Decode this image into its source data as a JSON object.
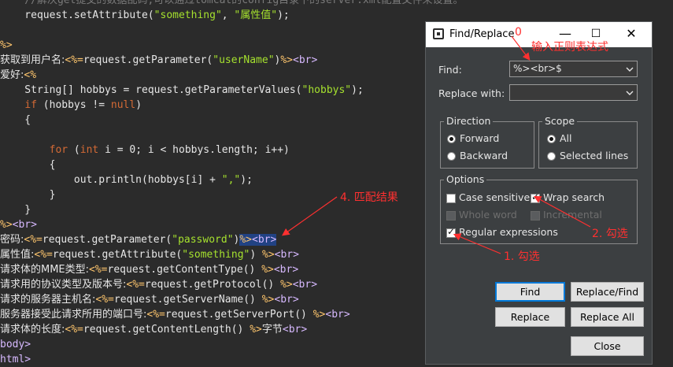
{
  "code_lines": [
    {
      "tokens": [
        {
          "t": "    //解决get提交的数据乱码,可以通过tomcat的config目录下的server.xml配置文件来设置。",
          "c": "t-cmt"
        }
      ]
    },
    {
      "tokens": [
        {
          "t": "    request.setAttribute(",
          "c": "t-def"
        },
        {
          "t": "\"something\"",
          "c": "t-str"
        },
        {
          "t": ", ",
          "c": "t-def"
        },
        {
          "t": "\"属性值\"",
          "c": "t-str"
        },
        {
          "t": ");",
          "c": "t-def"
        }
      ]
    },
    {
      "tokens": []
    },
    {
      "tokens": [
        {
          "t": "%>",
          "c": "t-tag"
        }
      ]
    },
    {
      "tokens": [
        {
          "t": "获取到用户名:",
          "c": "t-cn"
        },
        {
          "t": "<%=",
          "c": "t-tag"
        },
        {
          "t": "request.getParameter(",
          "c": "t-def"
        },
        {
          "t": "\"userName\"",
          "c": "t-str"
        },
        {
          "t": ")",
          "c": "t-def"
        },
        {
          "t": "%>",
          "c": "t-tag"
        },
        {
          "t": "<br>",
          "c": "t-html"
        }
      ]
    },
    {
      "tokens": [
        {
          "t": "爱好:",
          "c": "t-cn"
        },
        {
          "t": "<%",
          "c": "t-tag"
        }
      ]
    },
    {
      "tokens": [
        {
          "t": "    String[] hobbys = request.getParameterValues(",
          "c": "t-def"
        },
        {
          "t": "\"hobbys\"",
          "c": "t-str"
        },
        {
          "t": ");",
          "c": "t-def"
        }
      ]
    },
    {
      "tokens": [
        {
          "t": "    ",
          "c": "t-def"
        },
        {
          "t": "if",
          "c": "t-kw"
        },
        {
          "t": " (hobbys != ",
          "c": "t-def"
        },
        {
          "t": "null",
          "c": "t-kw"
        },
        {
          "t": ")",
          "c": "t-def"
        }
      ]
    },
    {
      "tokens": [
        {
          "t": "    {",
          "c": "t-def"
        }
      ]
    },
    {
      "tokens": []
    },
    {
      "tokens": [
        {
          "t": "        ",
          "c": "t-def"
        },
        {
          "t": "for",
          "c": "t-kw"
        },
        {
          "t": " (",
          "c": "t-def"
        },
        {
          "t": "int",
          "c": "t-kw"
        },
        {
          "t": " i = 0; i < hobbys.length; i++)",
          "c": "t-def"
        }
      ]
    },
    {
      "tokens": [
        {
          "t": "        {",
          "c": "t-def"
        }
      ]
    },
    {
      "tokens": [
        {
          "t": "            out.println(hobbys[i] + ",
          "c": "t-def"
        },
        {
          "t": "\",\"",
          "c": "t-str"
        },
        {
          "t": ");",
          "c": "t-def"
        }
      ]
    },
    {
      "tokens": [
        {
          "t": "        }",
          "c": "t-def"
        }
      ]
    },
    {
      "tokens": [
        {
          "t": "    }",
          "c": "t-def"
        }
      ]
    },
    {
      "tokens": [
        {
          "t": "%>",
          "c": "t-tag"
        },
        {
          "t": "<br>",
          "c": "t-html"
        }
      ]
    },
    {
      "tokens": [
        {
          "t": "密码:",
          "c": "t-cn"
        },
        {
          "t": "<%=",
          "c": "t-tag"
        },
        {
          "t": "request.getParameter(",
          "c": "t-def"
        },
        {
          "t": "\"password\"",
          "c": "t-str"
        },
        {
          "t": ")",
          "c": "t-def"
        },
        {
          "t": "%>",
          "c": "t-tag",
          "hl": true
        },
        {
          "t": "<br>",
          "c": "t-html",
          "hl": true
        }
      ]
    },
    {
      "tokens": [
        {
          "t": "属性值:",
          "c": "t-cn"
        },
        {
          "t": "<%=",
          "c": "t-tag"
        },
        {
          "t": "request.getAttribute(",
          "c": "t-def"
        },
        {
          "t": "\"something\"",
          "c": "t-str"
        },
        {
          "t": ") ",
          "c": "t-def"
        },
        {
          "t": "%>",
          "c": "t-tag"
        },
        {
          "t": "<br>",
          "c": "t-html"
        }
      ]
    },
    {
      "tokens": [
        {
          "t": "请求体的MME类型:",
          "c": "t-cn"
        },
        {
          "t": "<%=",
          "c": "t-tag"
        },
        {
          "t": "request.getContentType() ",
          "c": "t-def"
        },
        {
          "t": "%>",
          "c": "t-tag"
        },
        {
          "t": "<br>",
          "c": "t-html"
        }
      ]
    },
    {
      "tokens": [
        {
          "t": "请求用的协议类型及版本号:",
          "c": "t-cn"
        },
        {
          "t": "<%=",
          "c": "t-tag"
        },
        {
          "t": "request.getProtocol() ",
          "c": "t-def"
        },
        {
          "t": "%>",
          "c": "t-tag"
        },
        {
          "t": "<br>",
          "c": "t-html"
        }
      ]
    },
    {
      "tokens": [
        {
          "t": "请求的服务器主机名:",
          "c": "t-cn"
        },
        {
          "t": "<%=",
          "c": "t-tag"
        },
        {
          "t": "request.getServerName() ",
          "c": "t-def"
        },
        {
          "t": "%>",
          "c": "t-tag"
        },
        {
          "t": "<br>",
          "c": "t-html"
        }
      ]
    },
    {
      "tokens": [
        {
          "t": "服务器接受此请求所用的端口号:",
          "c": "t-cn"
        },
        {
          "t": "<%=",
          "c": "t-tag"
        },
        {
          "t": "request.getServerPort() ",
          "c": "t-def"
        },
        {
          "t": "%>",
          "c": "t-tag"
        },
        {
          "t": "<br>",
          "c": "t-html"
        }
      ]
    },
    {
      "tokens": [
        {
          "t": "请求体的长度:",
          "c": "t-cn"
        },
        {
          "t": "<%=",
          "c": "t-tag"
        },
        {
          "t": "request.getContentLength() ",
          "c": "t-def"
        },
        {
          "t": "%>",
          "c": "t-tag"
        },
        {
          "t": "字节",
          "c": "t-cn"
        },
        {
          "t": "<br>",
          "c": "t-html"
        }
      ]
    },
    {
      "tokens": [
        {
          "t": "body>",
          "c": "t-html"
        }
      ]
    },
    {
      "tokens": [
        {
          "t": "html>",
          "c": "t-html"
        }
      ]
    }
  ],
  "dialog": {
    "title": "Find/Replace",
    "find_label": "Find:",
    "find_value": "%><br>$",
    "replace_label": "Replace with:",
    "replace_value": "",
    "direction_title": "Direction",
    "forward": "Forward",
    "backward": "Backward",
    "scope_title": "Scope",
    "all": "All",
    "selected_lines": "Selected lines",
    "options_title": "Options",
    "case_sensitive": "Case sensitive",
    "wrap_search": "Wrap search",
    "whole_word": "Whole word",
    "incremental": "Incremental",
    "regular_expressions": "Regular expressions",
    "btn_find": "Find",
    "btn_replace_find": "Replace/Find",
    "btn_replace": "Replace",
    "btn_replace_all": "Replace All",
    "btn_close": "Close",
    "state": {
      "direction": "forward",
      "scope": "all",
      "case_sensitive": false,
      "wrap_search": true,
      "whole_word": false,
      "incremental": false,
      "regular_expressions": true
    }
  },
  "annotations": {
    "zero": "0",
    "input_regex": "输入正则表达式",
    "match_result": "4. 匹配结果",
    "check2": "2. 勾选",
    "check1": "1. 勾选",
    "color": "#ff3030"
  }
}
